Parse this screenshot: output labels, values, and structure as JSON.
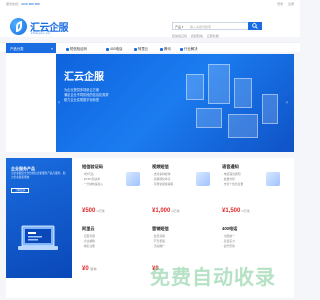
{
  "topbar": {
    "hotline_label": "服务热线：",
    "hotline_number": "4008-888-888",
    "links": [
      "登录",
      "注册"
    ]
  },
  "logo": {
    "name": "汇云企服",
    "sub": "zhuiyun.cn"
  },
  "search": {
    "category": "产品 ▾",
    "placeholder": "输入关键词搜索",
    "hotwords": [
      "短信验证码",
      "视频短信",
      "云服务器"
    ]
  },
  "nav": {
    "categories_label": "产品分类",
    "items": [
      "短信验证码",
      "400电话",
      "阿里云",
      "腾讯",
      "行业解决"
    ]
  },
  "hero": {
    "title": "汇云企服",
    "lines": [
      "为企业提供多场景云方案",
      "满足企业不同阶段的信息化需求",
      "助力企业实现数字化转型"
    ]
  },
  "promo": {
    "title": "企业服务产品",
    "desc": "为企业提供全方位的信息化服务产品与服务，助力企业提质增效",
    "button": "了解更多"
  },
  "products": [
    {
      "name": "短信验证码",
      "features": [
        "3秒可达",
        "99.9%到达率",
        "一分钟快速接入"
      ],
      "tag": "",
      "price": "¥500",
      "unit": "/1万条"
    },
    {
      "name": "视频短信",
      "features": [
        "支持多种媒体",
        "营销转化率高",
        "可视化模板编辑"
      ],
      "tag": "",
      "price": "¥1,000",
      "unit": "/1万条"
    },
    {
      "name": "语音通知",
      "features": [
        "电话语音通知",
        "批量外呼",
        "支持个性化变量"
      ],
      "tag": "",
      "price": "¥1,500",
      "unit": "/1万条"
    },
    {
      "name": "阿里云",
      "features": [
        "云服务器",
        "企业邮箱",
        "域名注册"
      ],
      "tag": "",
      "price": "¥0",
      "unit": "/咨询"
    },
    {
      "name": "营销短信",
      "features": [
        "会员营销",
        "节日祝福",
        "活动推广"
      ],
      "tag": "",
      "price": "¥0",
      "unit": ""
    },
    {
      "name": "400电话",
      "features": [
        "全国统一",
        "彰显实力",
        "提升形象"
      ],
      "tag": "",
      "price": "",
      "unit": ""
    }
  ],
  "watermark": "免费自动收录",
  "colors": {
    "brand": "#1a6de0",
    "price": "#e02b2b",
    "background": "#f4f6fa"
  }
}
